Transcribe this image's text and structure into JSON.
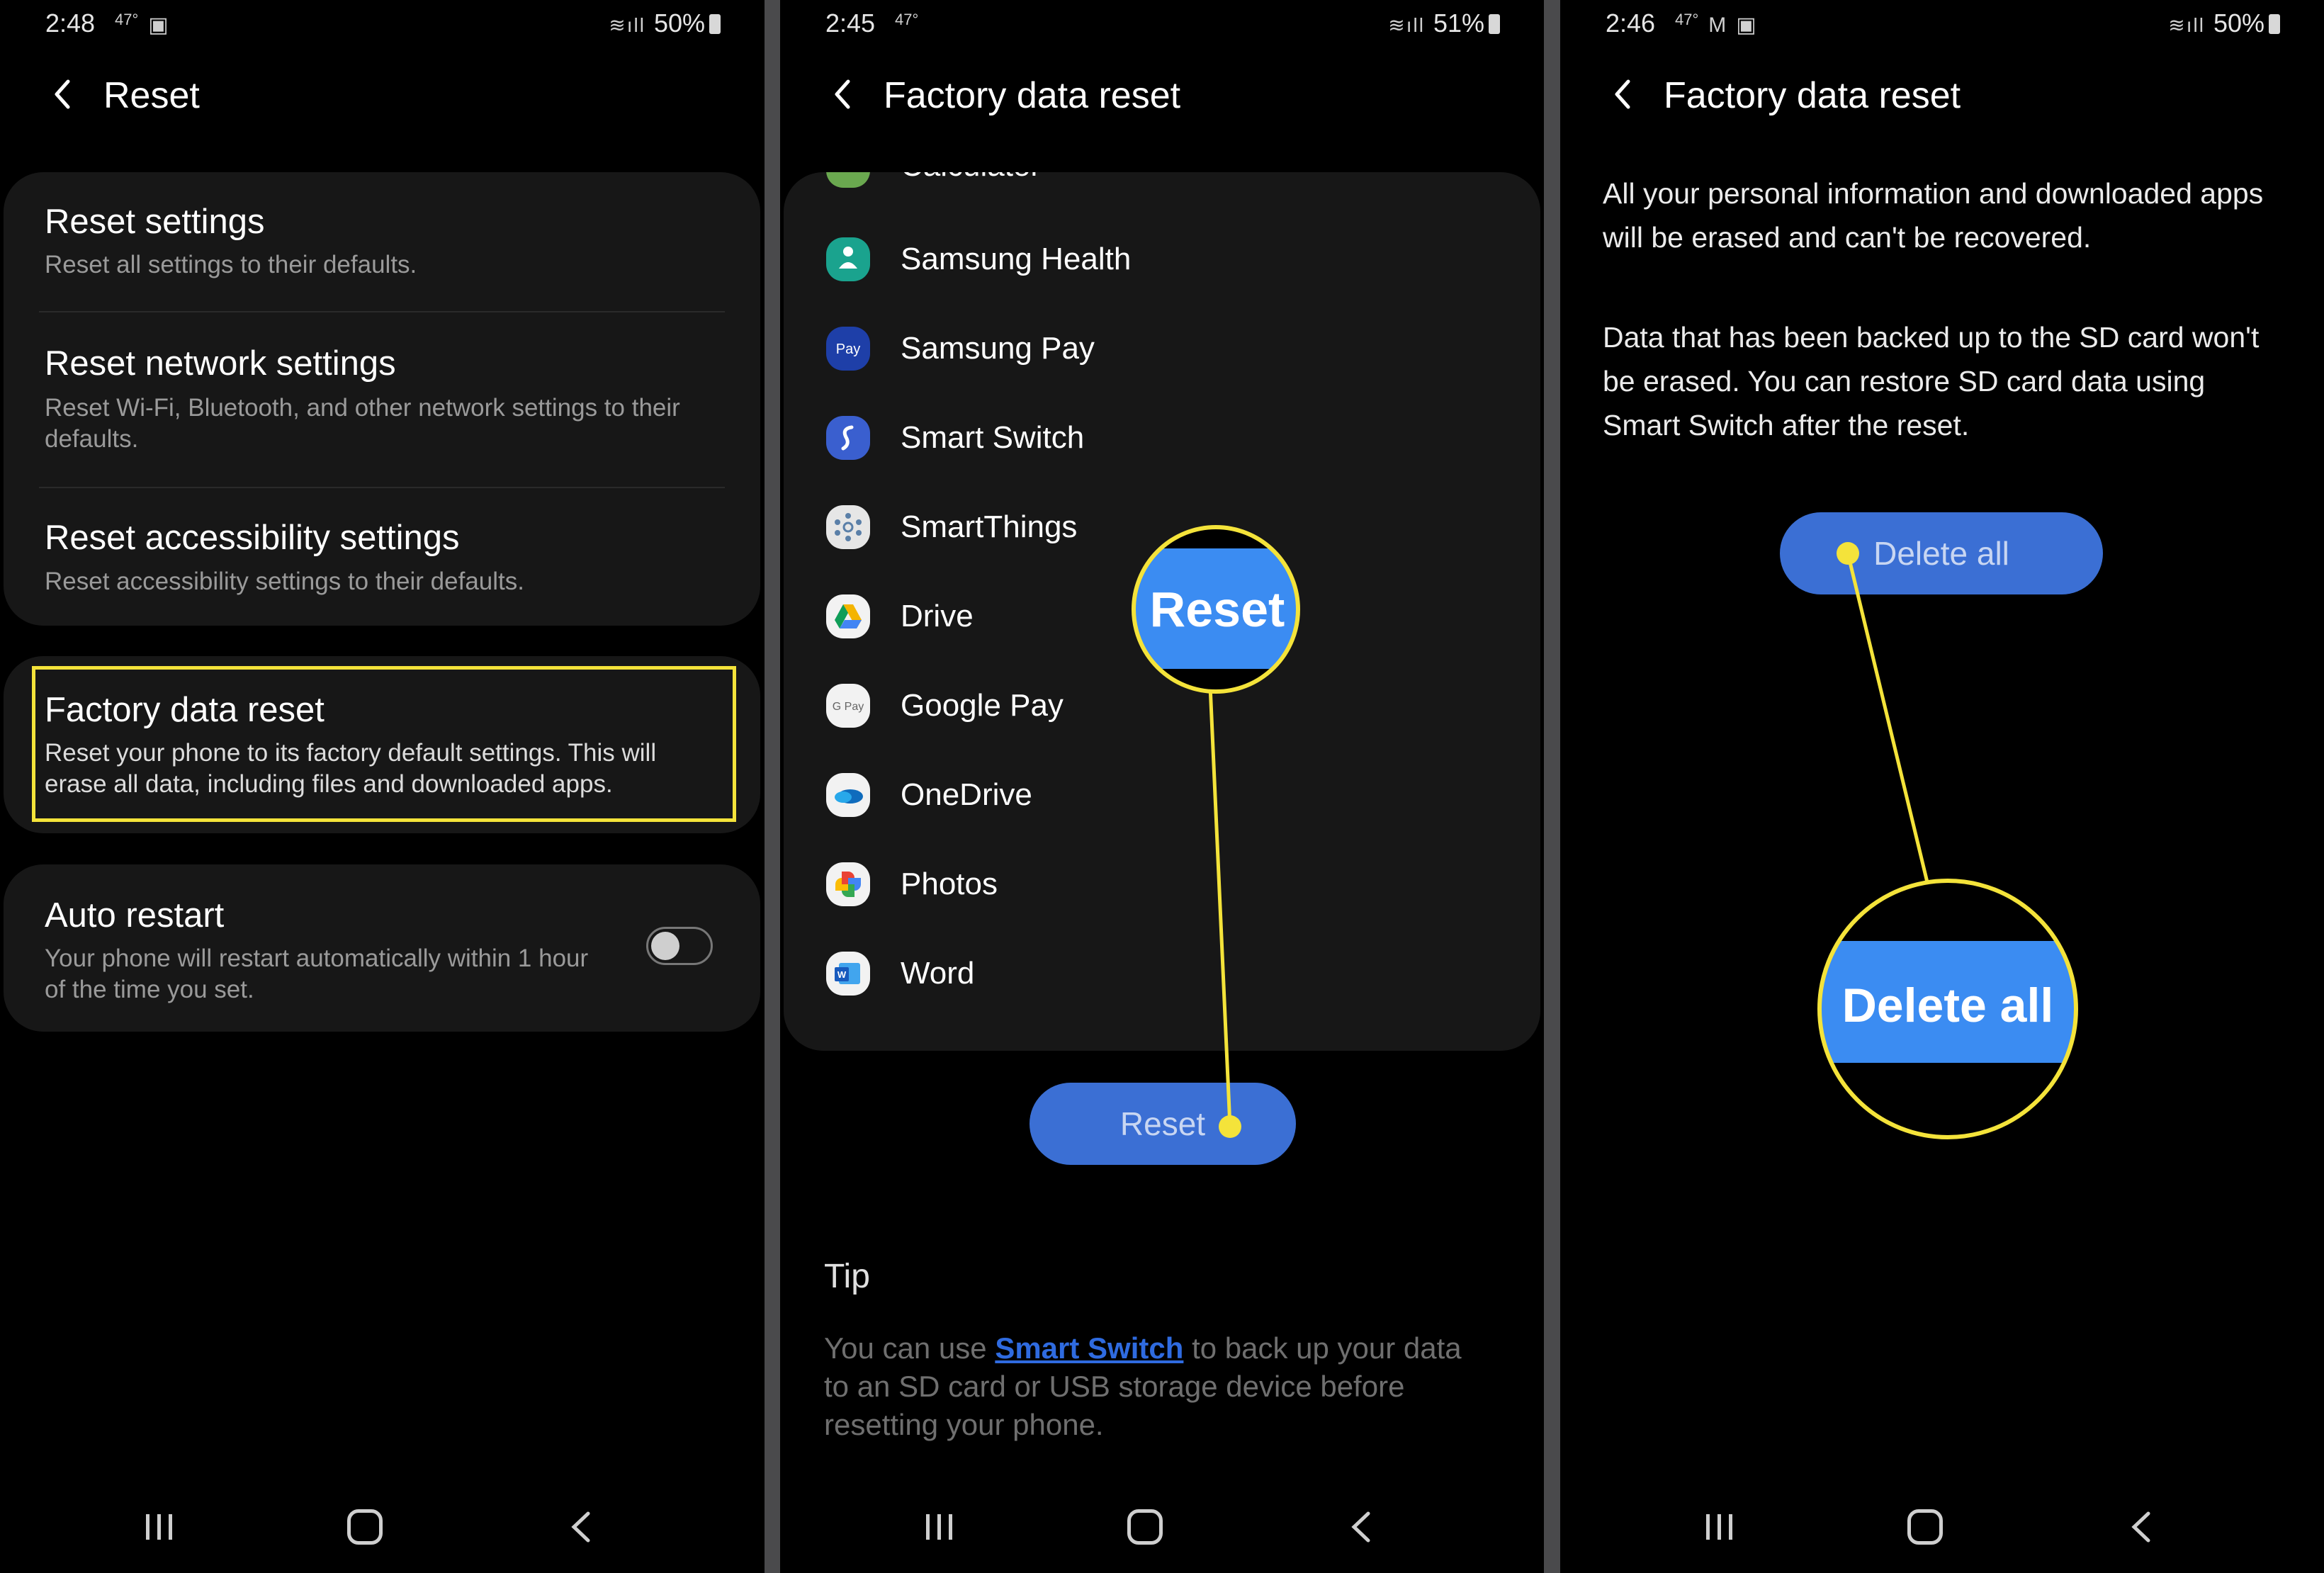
{
  "screen1": {
    "status": {
      "time": "2:48",
      "temp": "47°",
      "battery": "50%"
    },
    "header": {
      "title": "Reset"
    },
    "items": [
      {
        "title": "Reset settings",
        "subtitle": "Reset all settings to their defaults."
      },
      {
        "title": "Reset network settings",
        "subtitle": "Reset Wi-Fi, Bluetooth, and other network settings to their defaults."
      },
      {
        "title": "Reset accessibility settings",
        "subtitle": "Reset accessibility settings to their defaults."
      },
      {
        "title": "Factory data reset",
        "subtitle": "Reset your phone to its factory default settings. This will erase all data, including files and downloaded apps."
      },
      {
        "title": "Auto restart",
        "subtitle": "Your phone will restart automatically within 1 hour of the time you set.",
        "toggle_on": false
      }
    ]
  },
  "screen2": {
    "status": {
      "time": "2:45",
      "temp": "47°",
      "battery": "51%"
    },
    "header": {
      "title": "Factory data reset"
    },
    "apps": [
      {
        "label": "Calculator",
        "icon": "calculator-icon",
        "color": "#6aa84f"
      },
      {
        "label": "Samsung Health",
        "icon": "samsung-health-icon",
        "color": "#1aa38e"
      },
      {
        "label": "Samsung Pay",
        "icon": "samsung-pay-icon",
        "color": "#1e3fa8"
      },
      {
        "label": "Smart Switch",
        "icon": "smart-switch-icon",
        "color": "#3a5fcf"
      },
      {
        "label": "SmartThings",
        "icon": "smartthings-icon",
        "color": "#e6e6e6"
      },
      {
        "label": "Drive",
        "icon": "drive-icon",
        "color": "#f2f2f2"
      },
      {
        "label": "Google Pay",
        "icon": "google-pay-icon",
        "color": "#f2f2f2"
      },
      {
        "label": "OneDrive",
        "icon": "onedrive-icon",
        "color": "#f2f2f2"
      },
      {
        "label": "Photos",
        "icon": "photos-icon",
        "color": "#f2f2f2"
      },
      {
        "label": "Word",
        "icon": "word-icon",
        "color": "#f2f2f2"
      }
    ],
    "reset_button": "Reset",
    "callout_label": "Reset",
    "tip": {
      "title": "Tip",
      "before": "You can use ",
      "link": "Smart Switch",
      "after": " to back up your data to an SD card or USB storage device before resetting your phone."
    }
  },
  "screen3": {
    "status": {
      "time": "2:46",
      "temp": "47°",
      "battery": "50%"
    },
    "header": {
      "title": "Factory data reset"
    },
    "para1": "All your personal information and downloaded apps will be erased and can't be recovered.",
    "para2": "Data that has been backed up to the SD card won't be erased. You can restore SD card data using Smart Switch after the reset.",
    "delete_button": "Delete all",
    "callout_label": "Delete all"
  },
  "colors": {
    "highlight": "#f4e33a",
    "button": "#3b6fd4",
    "link": "#2f6be0"
  }
}
